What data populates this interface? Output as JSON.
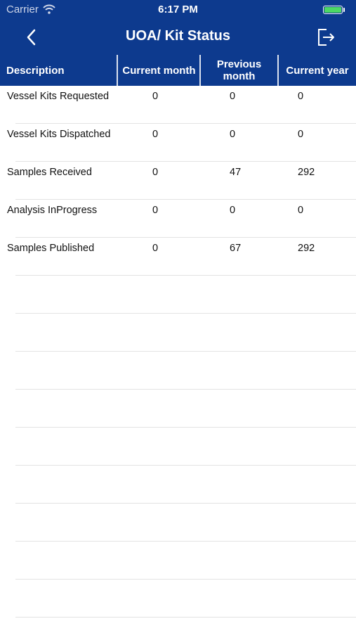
{
  "status_bar": {
    "carrier": "Carrier",
    "time": "6:17 PM"
  },
  "nav": {
    "title": "UOA/ Kit Status"
  },
  "colors": {
    "header_bg": "#0d3a8e",
    "battery": "#4cd964",
    "separator": "#e3e3e3"
  },
  "table": {
    "columns": {
      "description": "Description",
      "current_month": "Current month",
      "previous_month": "Previous month",
      "current_year": "Current year"
    },
    "rows": [
      {
        "description": "Vessel Kits Requested",
        "current_month": "0",
        "previous_month": "0",
        "current_year": "0"
      },
      {
        "description": "Vessel Kits Dispatched",
        "current_month": "0",
        "previous_month": "0",
        "current_year": "0"
      },
      {
        "description": "Samples Received",
        "current_month": "0",
        "previous_month": "47",
        "current_year": "292"
      },
      {
        "description": "Analysis InProgress",
        "current_month": "0",
        "previous_month": "0",
        "current_year": "0"
      },
      {
        "description": "Samples Published",
        "current_month": "0",
        "previous_month": "67",
        "current_year": "292"
      }
    ]
  }
}
